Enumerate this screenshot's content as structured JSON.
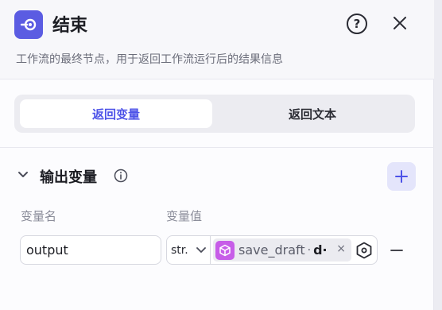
{
  "header": {
    "title": "结束",
    "description": "工作流的最终节点，用于返回工作流运行后的结果信息",
    "node_icon": "end-node-icon",
    "help_icon": "help-circle-icon",
    "help_glyph": "?",
    "close_icon": "close-icon"
  },
  "tabs": [
    {
      "label": "返回变量",
      "active": true
    },
    {
      "label": "返回文本",
      "active": false
    }
  ],
  "output_section": {
    "title": "输出变量",
    "columns": {
      "name": "变量名",
      "value": "变量值"
    },
    "rows": [
      {
        "name": "output",
        "type": "str.",
        "ref_node": "save_draft",
        "ref_separator": "·",
        "ref_field": "d·",
        "tag_close": "×"
      }
    ]
  },
  "colors": {
    "accent": "#4d53e8",
    "node_icon_bg": "#5b5ce2",
    "tag_icon_bg": "#c75de8",
    "add_button_bg": "#e4e5fb"
  }
}
